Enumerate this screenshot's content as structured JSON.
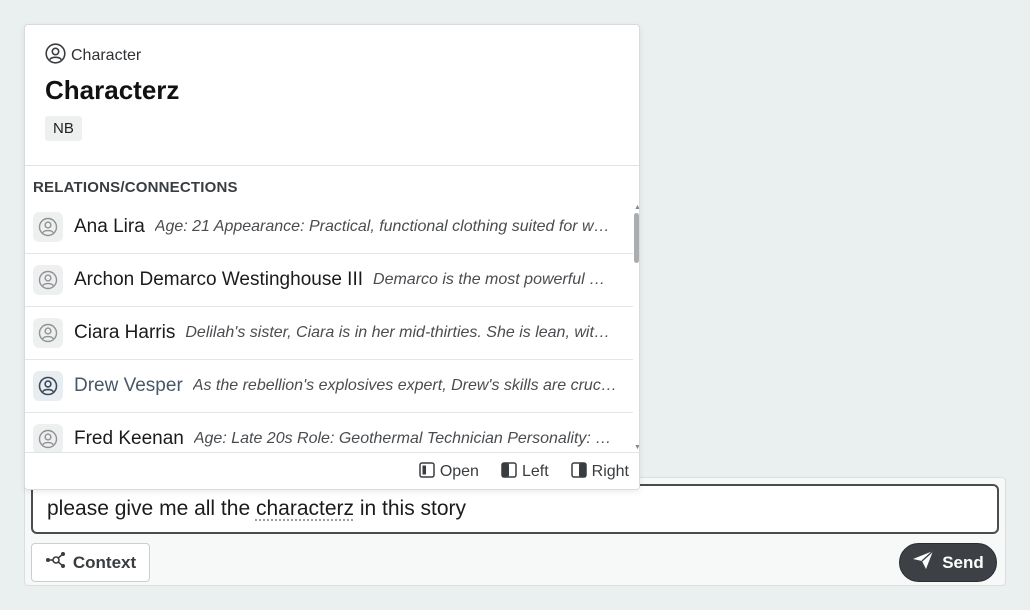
{
  "card": {
    "type_label": "Character",
    "title": "Characterz",
    "badge": "NB",
    "section_label": "RELATIONS/CONNECTIONS",
    "relations": [
      {
        "name": "Ana Lira",
        "desc": "Age: 21 Appearance: Practical, functional clothing suited for work in a harsh environment"
      },
      {
        "name": "Archon Demarco Westinghouse III",
        "desc": "Demarco is the most powerful man in the city"
      },
      {
        "name": "Ciara Harris",
        "desc": "Delilah's sister, Ciara is in her mid-thirties. She is lean, with sharp features"
      },
      {
        "name": "Drew Vesper",
        "desc": "As the rebellion's explosives expert, Drew's skills are crucial to every operation"
      },
      {
        "name": "Fred Keenan",
        "desc": "Age: Late 20s Role: Geothermal Technician Personality: Quiet and methodical"
      }
    ],
    "footer": {
      "open_label": "Open",
      "left_label": "Left",
      "right_label": "Right"
    }
  },
  "composer": {
    "input_before": "please give me all the ",
    "input_underlined": "characterz",
    "input_after": " in this story",
    "context_label": "Context",
    "send_label": "Send"
  },
  "icons": {
    "type": "user-circle-icon",
    "avatar": "user-circle-icon",
    "open": "panel-open-icon",
    "left": "panel-left-icon",
    "right": "panel-right-icon",
    "context": "graph-nodes-icon",
    "send": "paper-plane-icon"
  },
  "colors": {
    "accent_dark": "#3d4145",
    "active_name": "#48586a",
    "background": "#eaf0ef"
  }
}
